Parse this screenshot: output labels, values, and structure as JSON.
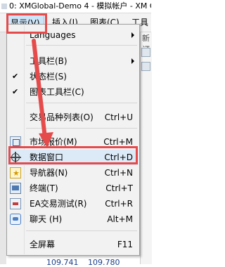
{
  "window": {
    "title": "0: XMGlobal-Demo 4 - 模拟帐户 - XM Gl"
  },
  "menubar": {
    "items": [
      {
        "label": "显示(V)",
        "active": true
      },
      {
        "label": "插入(I)"
      },
      {
        "label": "图表(C)"
      },
      {
        "label": "工具"
      }
    ]
  },
  "background": {
    "right_text": "新订",
    "bottom_prices": [
      "109.741",
      "109.780"
    ]
  },
  "view_menu": {
    "languages": "Languages",
    "toolbars": {
      "label": "工具栏(B)"
    },
    "status_bar": {
      "label": "状态栏(S)",
      "checked": true
    },
    "chart_toolbar": {
      "label": "图表工具栏(C)",
      "checked": true
    },
    "symbols": {
      "label": "交易品种列表(O)",
      "shortcut": "Ctrl+U"
    },
    "market_watch": {
      "label": "市场报价(M)",
      "shortcut": "Ctrl+M",
      "icon": "market-watch-icon"
    },
    "data_window": {
      "label": "数据窗口",
      "shortcut": "Ctrl+D",
      "icon": "crosshair-icon",
      "highlighted": true
    },
    "navigator": {
      "label": "导航器(N)",
      "shortcut": "Ctrl+N",
      "icon": "navigator-icon"
    },
    "terminal": {
      "label": "终端(T)",
      "shortcut": "Ctrl+T",
      "icon": "terminal-icon"
    },
    "strategy_tester": {
      "label": "EA交易测试(R)",
      "shortcut": "Ctrl+R",
      "icon": "tester-icon"
    },
    "chat": {
      "label": "聊天 (H)",
      "shortcut": "Alt+M",
      "icon": "chat-icon"
    },
    "fullscreen": {
      "label": "全屏幕",
      "shortcut": "F11"
    }
  },
  "annotation": {
    "color": "#e64b4b"
  }
}
